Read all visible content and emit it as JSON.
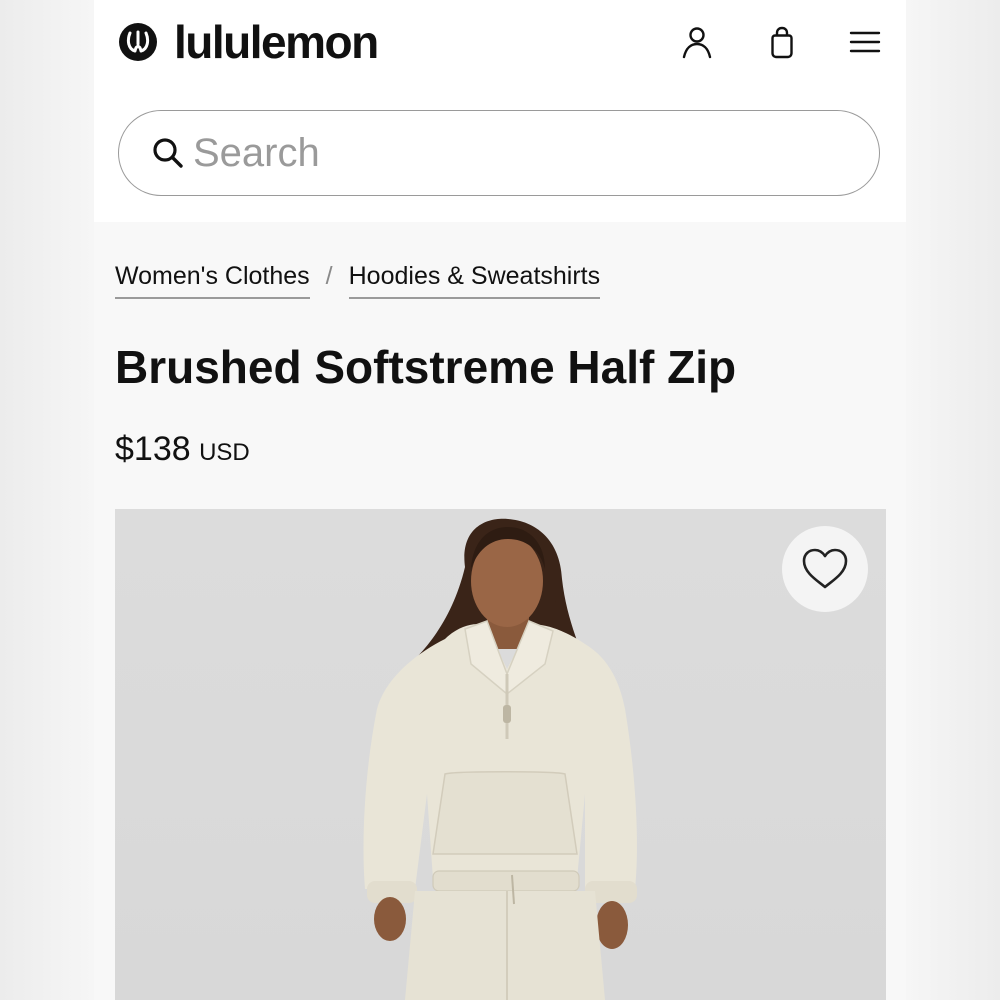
{
  "header": {
    "brand": "lululemon",
    "icons": [
      "lululemon-logo-icon",
      "account-icon",
      "shopping-bag-icon",
      "menu-icon"
    ]
  },
  "search": {
    "placeholder": "Search",
    "value": ""
  },
  "breadcrumb": {
    "items": [
      {
        "label": "Women's Clothes"
      },
      {
        "label": "Hoodies & Sweatshirts"
      }
    ],
    "separator": "/"
  },
  "product": {
    "title": "Brushed Softstreme Half Zip",
    "price": "$138",
    "currency": "USD",
    "image_alt": "Model wearing a cream Brushed Softstreme Half Zip pullover with matching pants"
  },
  "colors": {
    "text": "#111111",
    "muted": "#9a9a9a",
    "header_bg": "#ffffff",
    "page_bg": "#f8f8f8",
    "product_fabric": "#e9e5d7",
    "photo_bg": "#dadada"
  }
}
